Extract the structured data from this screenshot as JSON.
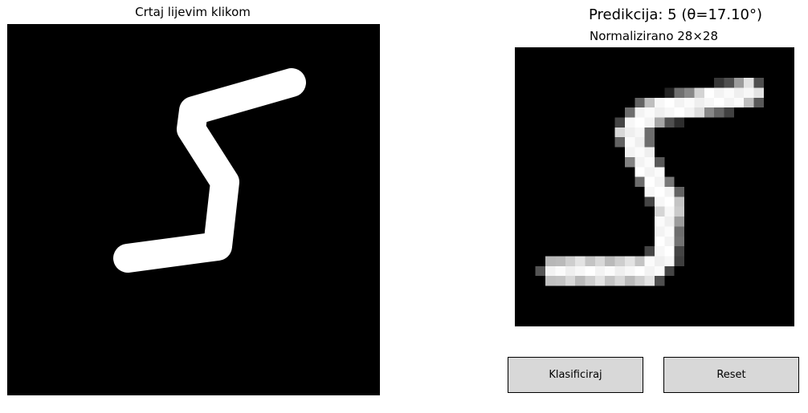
{
  "draw_panel": {
    "title": "Crtaj lijevim klikom"
  },
  "result_panel": {
    "prediction_title": "Predikcija: 5  (θ=17.10°)",
    "normalized_title": "Normalizirano 28×28"
  },
  "buttons": {
    "classify_label": "Klasificiraj",
    "reset_label": "Reset"
  },
  "colors": {
    "canvas_background": "#000000",
    "stroke": "#ffffff",
    "button_background": "#d8d8d8"
  }
}
